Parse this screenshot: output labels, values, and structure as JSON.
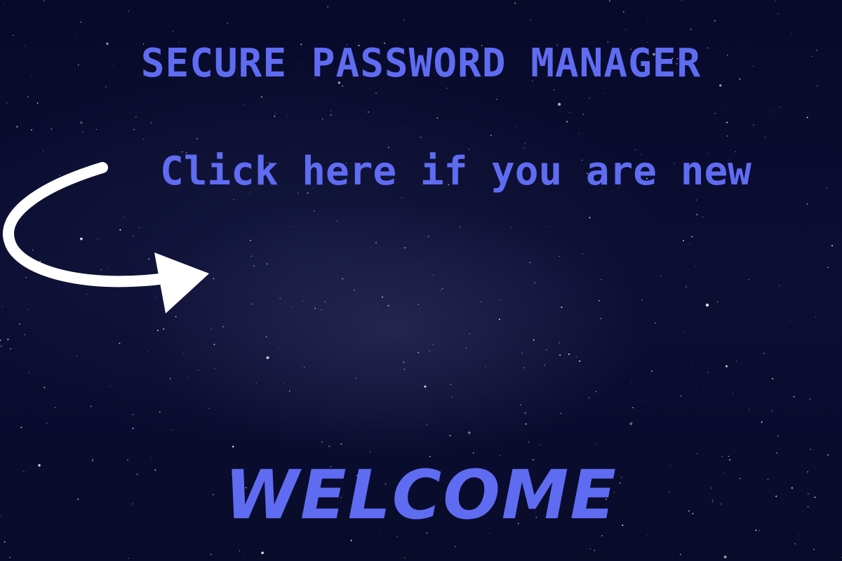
{
  "header": {
    "title": "SECURE PASSWORD MANAGER"
  },
  "main": {
    "new_user_link": "Click here if you are new",
    "arrow_icon": "curved-arrow-right-icon",
    "welcome_text": "WELCOME"
  },
  "colors": {
    "background": "#0a0b2b",
    "accent": "#5f6cf2",
    "arrow": "#ffffff"
  }
}
